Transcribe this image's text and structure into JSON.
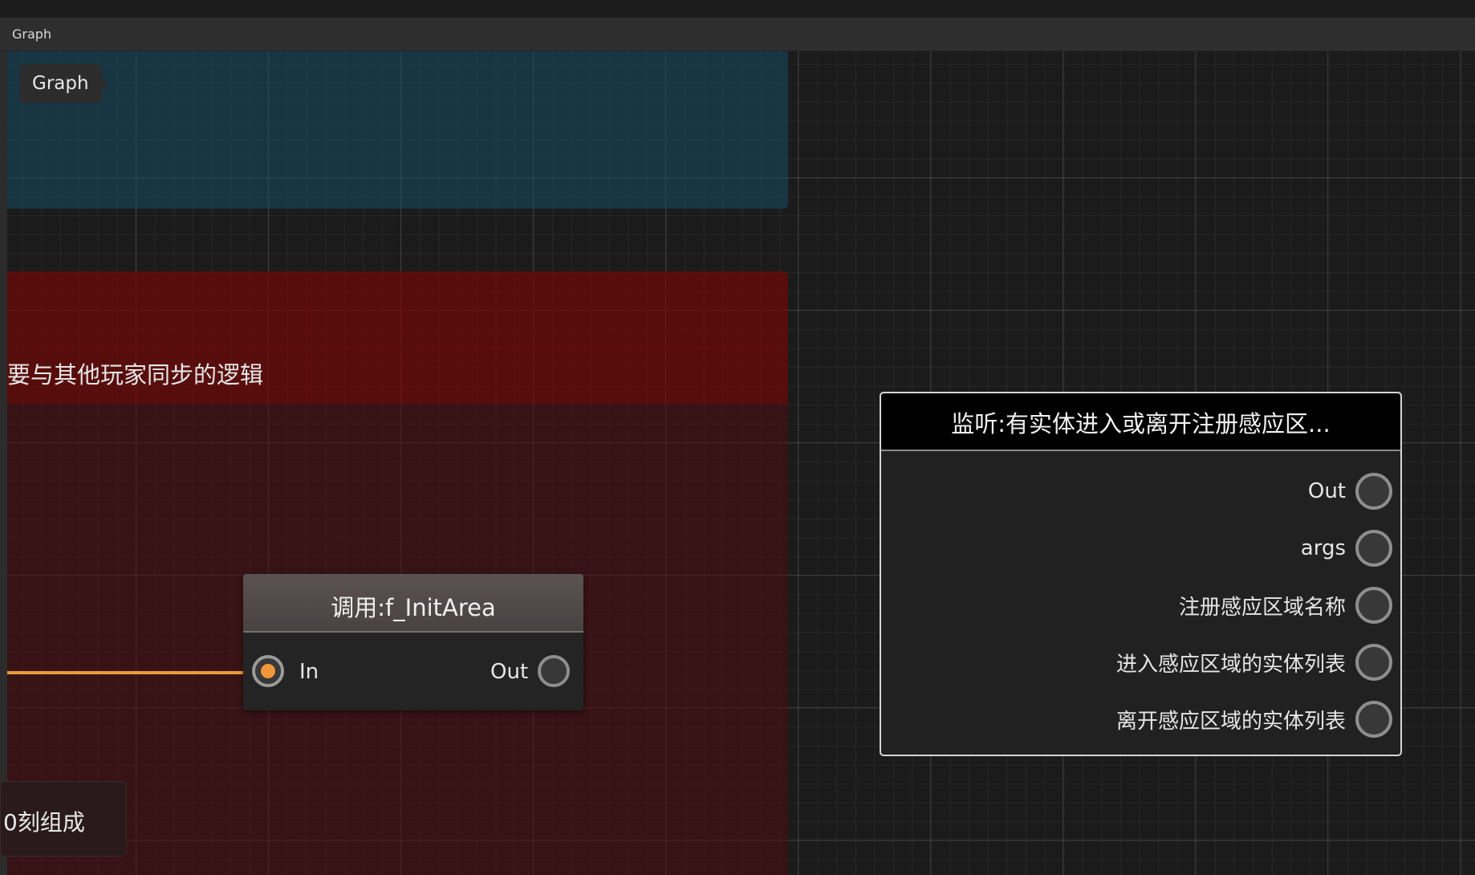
{
  "window": {
    "tab_title": "Graph"
  },
  "canvas": {
    "breadcrumb": "Graph",
    "groups": {
      "red_title": "要与其他玩家同步的逻辑",
      "comment_text": "0刻组成"
    }
  },
  "nodes": {
    "call_node": {
      "title": "调用:f_InitArea",
      "in_label": "In",
      "out_label": "Out"
    },
    "listen_node": {
      "title": "监听:有实体进入或离开注册感应区...",
      "outputs": [
        "Out",
        "args",
        "注册感应区域名称",
        "进入感应区域的实体列表",
        "离开感应区域的实体列表"
      ]
    }
  },
  "colors": {
    "wire": "#ee9a3a",
    "blue_group": "#164a66",
    "red_group": "#6e0a0a"
  }
}
